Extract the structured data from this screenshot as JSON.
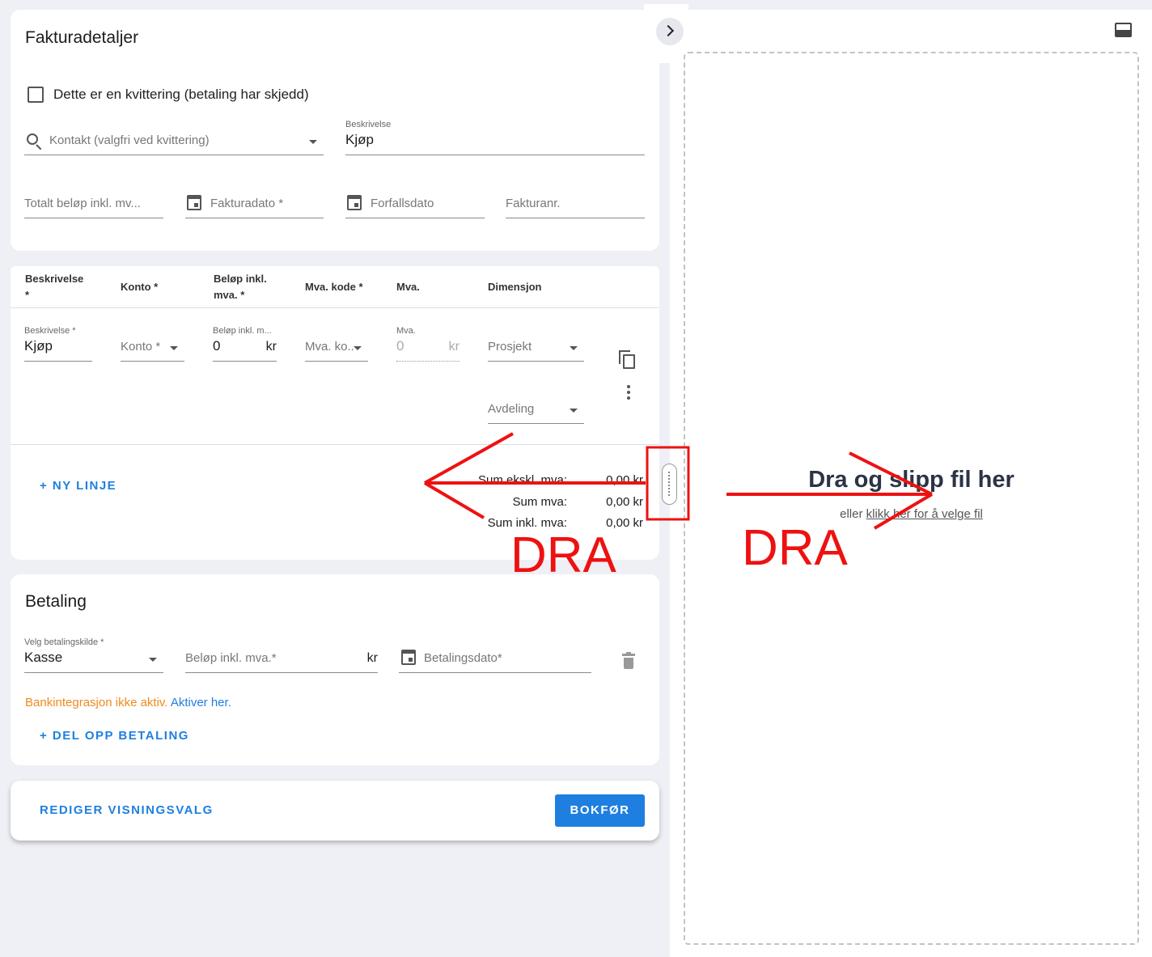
{
  "invoice_details": {
    "title": "Fakturadetaljer",
    "receipt_checkbox_label": "Dette er en kvittering (betaling har skjedd)",
    "receipt_checked": false,
    "contact_placeholder": "Kontakt (valgfri ved kvittering)",
    "description_label": "Beskrivelse",
    "description_value": "Kjøp",
    "total_placeholder": "Totalt beløp inkl. mv...",
    "invoice_date_placeholder": "Fakturadato *",
    "due_date_placeholder": "Forfallsdato",
    "invoice_no_placeholder": "Fakturanr."
  },
  "lines": {
    "headers": {
      "beskrivelse": "Beskrivelse",
      "beskrivelse_req": "*",
      "konto": "Konto *",
      "belop_1": "Beløp inkl.",
      "belop_2": "mva. *",
      "mva_kode": "Mva. kode *",
      "mva": "Mva.",
      "dimensjon": "Dimensjon"
    },
    "row": {
      "desc_label": "Beskrivelse *",
      "desc_value": "Kjøp",
      "konto_placeholder": "Konto *",
      "amount_label": "Beløp inkl. m...",
      "amount_value": "0",
      "amount_unit": "kr",
      "mva_code_placeholder": "Mva. ko...",
      "mva_label": "Mva.",
      "mva_value": "0",
      "mva_unit": "kr",
      "prosjekt_placeholder": "Prosjekt",
      "avdeling_placeholder": "Avdeling"
    },
    "new_line_label": "+ NY LINJE",
    "sums": [
      {
        "label": "Sum ekskl. mva:",
        "value": "0,00 kr"
      },
      {
        "label": "Sum mva:",
        "value": "0,00 kr"
      },
      {
        "label": "Sum inkl. mva:",
        "value": "0,00 kr"
      }
    ]
  },
  "payment": {
    "title": "Betaling",
    "source_label": "Velg betalingskilde *",
    "source_value": "Kasse",
    "amount_placeholder": "Beløp inkl. mva.*",
    "amount_unit": "kr",
    "date_placeholder": "Betalingsdato*",
    "bank_warning": "Bankintegrasjon ikke aktiv.",
    "activate_link": "Aktiver her.",
    "split_label": "+ DEL OPP BETALING"
  },
  "footer": {
    "edit_view_label": "REDIGER VISNINGSVALG",
    "submit_label": "BOKFØR"
  },
  "dropzone": {
    "title": "Dra og slipp fil her",
    "subtitle_prefix": "eller",
    "subtitle_link": "klikk her for å velge fil"
  },
  "annotations": {
    "left_text": "DRA",
    "right_text": "DRA",
    "color": "#ee1111"
  },
  "colors": {
    "accent": "#1e7fe0",
    "warning": "#f08a1c",
    "background": "#eef0f5"
  }
}
